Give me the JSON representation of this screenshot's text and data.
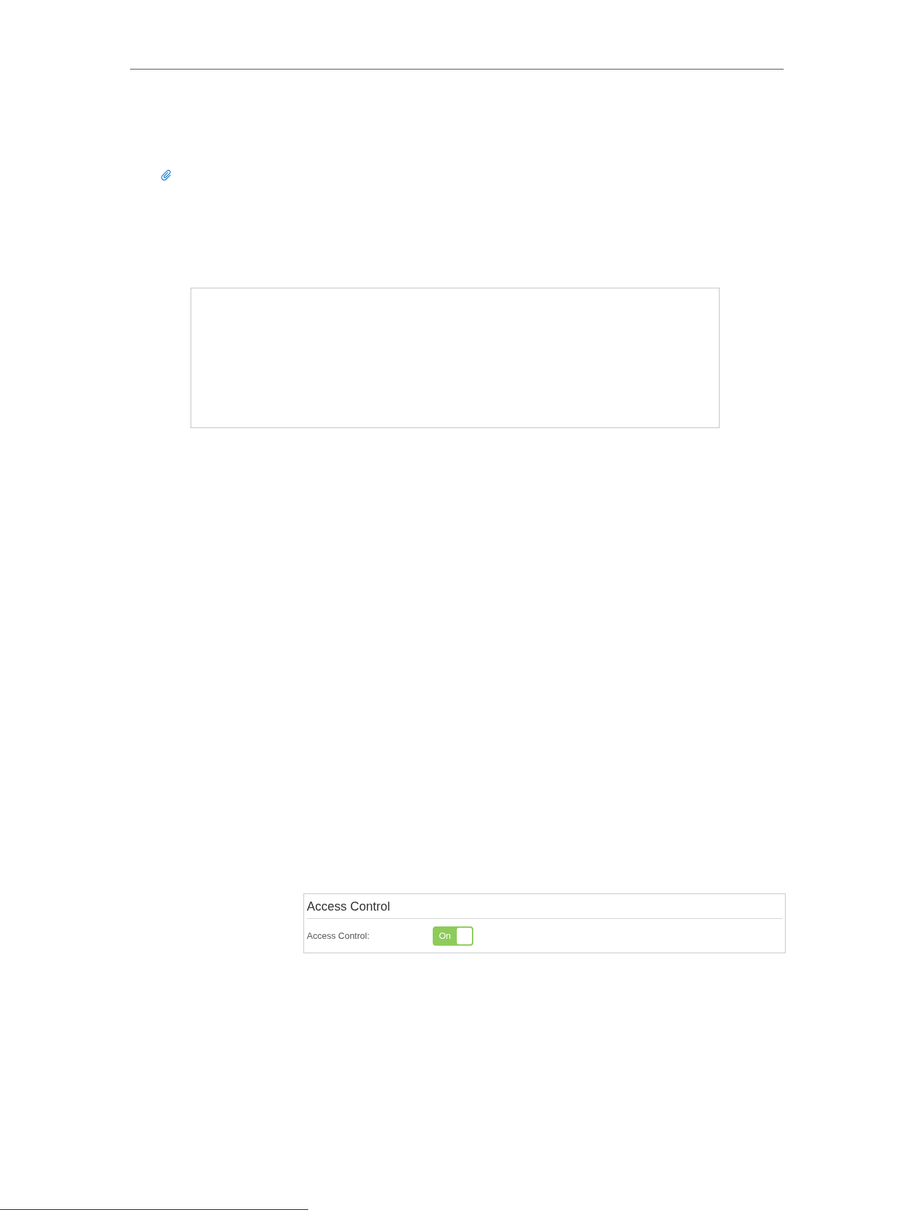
{
  "access_control_panel": {
    "title": "Access Control",
    "settings": [
      {
        "label": "Access Control:",
        "toggle_text": "On",
        "on": true
      }
    ]
  }
}
